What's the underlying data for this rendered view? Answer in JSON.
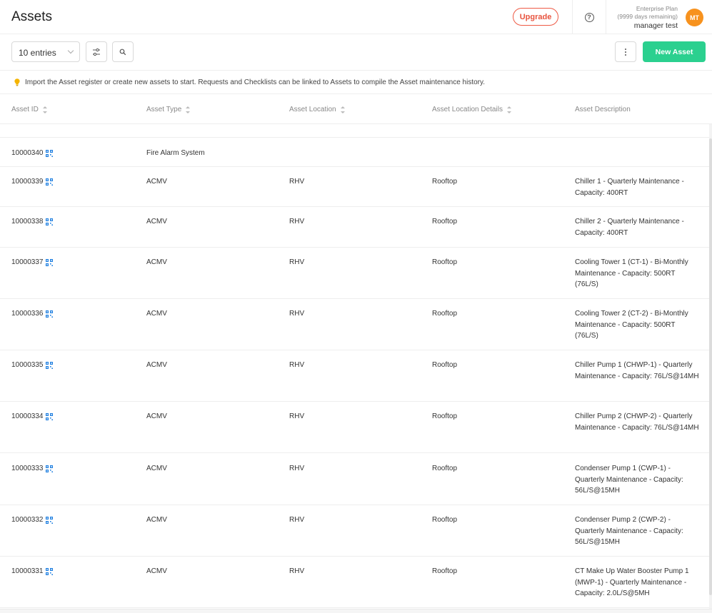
{
  "header": {
    "title": "Assets",
    "upgrade_label": "Upgrade",
    "plan_name": "Enterprise Plan",
    "plan_days": "(9999 days remaining)",
    "user_name": "manager test",
    "avatar_initials": "MT"
  },
  "toolbar": {
    "entries_value": "10 entries",
    "new_asset_label": "New Asset"
  },
  "info": {
    "text": "Import the Asset register or create new assets to start. Requests and Checklists can be linked to Assets to compile the Asset maintenance history."
  },
  "table": {
    "columns": [
      "Asset ID",
      "Asset Type",
      "Asset Location",
      "Asset Location Details",
      "Asset Description"
    ],
    "rows": [
      {
        "id": "10000340",
        "type": "Fire Alarm System",
        "location": "",
        "location_details": "",
        "description": ""
      },
      {
        "id": "10000339",
        "type": "ACMV",
        "location": "RHV",
        "location_details": "Rooftop",
        "description": "Chiller 1 - Quarterly Maintenance - Capacity: 400RT"
      },
      {
        "id": "10000338",
        "type": "ACMV",
        "location": "RHV",
        "location_details": "Rooftop",
        "description": "Chiller 2 - Quarterly Maintenance - Capacity: 400RT"
      },
      {
        "id": "10000337",
        "type": "ACMV",
        "location": "RHV",
        "location_details": "Rooftop",
        "description": "Cooling Tower 1 (CT-1) - Bi-Monthly Maintenance - Capacity: 500RT (76L/S)"
      },
      {
        "id": "10000336",
        "type": "ACMV",
        "location": "RHV",
        "location_details": "Rooftop",
        "description": "Cooling Tower 2 (CT-2) - Bi-Monthly Maintenance - Capacity: 500RT (76L/S)"
      },
      {
        "id": "10000335",
        "type": "ACMV",
        "location": "RHV",
        "location_details": "Rooftop",
        "description": "Chiller Pump 1 (CHWP-1) - Quarterly Maintenance - Capacity: 76L/S@14MH"
      },
      {
        "id": "10000334",
        "type": "ACMV",
        "location": "RHV",
        "location_details": "Rooftop",
        "description": "Chiller Pump 2 (CHWP-2) - Quarterly Maintenance - Capacity: 76L/S@14MH"
      },
      {
        "id": "10000333",
        "type": "ACMV",
        "location": "RHV",
        "location_details": "Rooftop",
        "description": "Condenser Pump 1 (CWP-1) - Quarterly Maintenance - Capacity: 56L/S@15MH"
      },
      {
        "id": "10000332",
        "type": "ACMV",
        "location": "RHV",
        "location_details": "Rooftop",
        "description": "Condenser Pump 2 (CWP-2) - Quarterly Maintenance - Capacity: 56L/S@15MH"
      },
      {
        "id": "10000331",
        "type": "ACMV",
        "location": "RHV",
        "location_details": "Rooftop",
        "description": "CT Make Up Water Booster Pump 1 (MWP-1) - Quarterly Maintenance - Capacity: 2.0L/S@5MH"
      }
    ]
  },
  "icons": {
    "qr": "qr-code-icon",
    "filter": "filter-icon",
    "search": "search-icon",
    "more": "more-vertical-icon",
    "bulb": "lightbulb-icon",
    "help": "help-icon"
  },
  "colors": {
    "accent": "#2bd08f",
    "upgrade": "#e8543f",
    "avatar": "#f7921e",
    "qr": "#1f7fe0",
    "bulb": "#f5b400"
  }
}
